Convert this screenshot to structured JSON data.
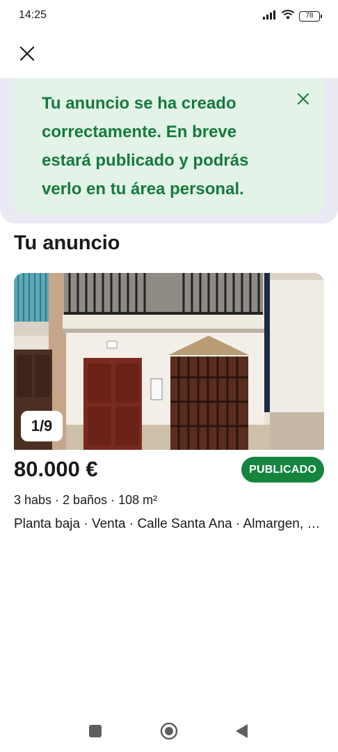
{
  "status_bar": {
    "time": "14:25",
    "battery": "78",
    "icons": [
      "signal-icon",
      "wifi-icon",
      "battery-icon"
    ]
  },
  "top_bar": {
    "close_icon": "close-icon"
  },
  "banner": {
    "message": "Tu anuncio se ha creado correctamente. En breve estará publicado y podrás verlo en tu área personal.",
    "close_icon": "close-icon",
    "text_color": "#157a3d",
    "background": "#e3f3e7"
  },
  "section": {
    "title": "Tu anuncio"
  },
  "listing": {
    "photo_counter": "1/9",
    "price": "80.000 €",
    "status": "PUBLICADO",
    "status_color": "#14843f",
    "features": "3 habs · 2 baños · 108 m²",
    "address": "Planta baja · Venta · Calle Santa Ana · Almargen, Málaga"
  },
  "nav": {
    "icons": [
      "recents-icon",
      "home-icon",
      "back-icon"
    ]
  }
}
